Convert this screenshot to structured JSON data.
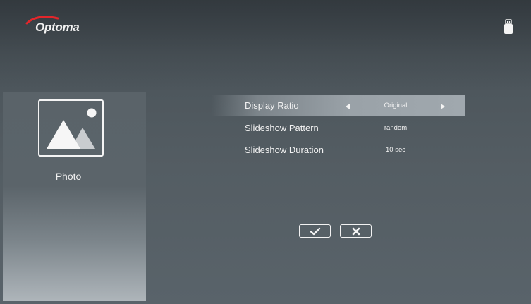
{
  "brand": {
    "logo_text": "Optoma",
    "swoosh_color": "#e3262b"
  },
  "status": {
    "storage_icon": "usb-drive-icon"
  },
  "sidebar": {
    "icon": "photo-landscape-icon",
    "label": "Photo"
  },
  "settings": {
    "rows": [
      {
        "label": "Display Ratio",
        "value": "Original",
        "selected": true,
        "has_arrows": true
      },
      {
        "label": "Slideshow Pattern",
        "value": "random",
        "selected": false,
        "has_arrows": false
      },
      {
        "label": "Slideshow Duration",
        "value": "10 sec",
        "selected": false,
        "has_arrows": false
      }
    ]
  },
  "actions": {
    "confirm_icon": "checkmark-icon",
    "cancel_icon": "x-icon"
  },
  "colors": {
    "text": "#f2f2f2",
    "selected_row": "#9aa2a8"
  }
}
